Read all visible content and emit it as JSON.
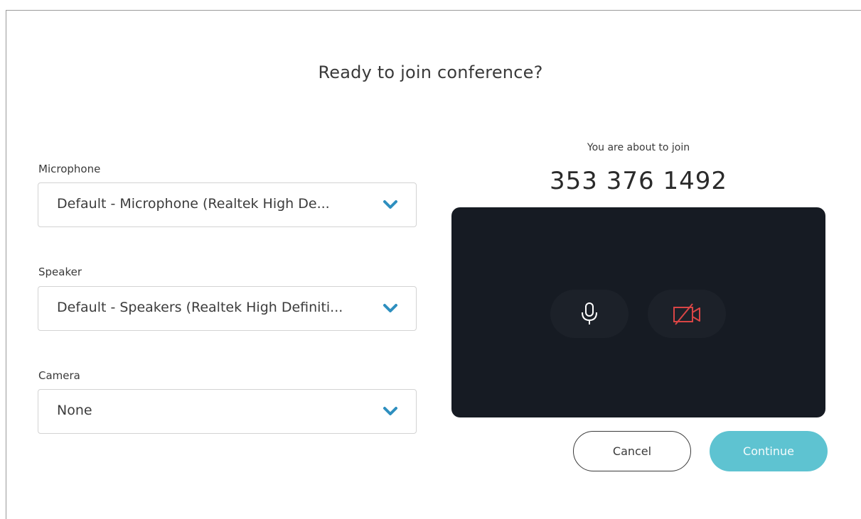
{
  "dialog": {
    "title": "Ready to join conference?"
  },
  "devices": {
    "microphone": {
      "label": "Microphone",
      "value": "Default - Microphone (Realtek High De..."
    },
    "speaker": {
      "label": "Speaker",
      "value": "Default - Speakers (Realtek High Definiti..."
    },
    "camera": {
      "label": "Camera",
      "value": "None"
    }
  },
  "join": {
    "caption": "You are about to join",
    "number": "353 376 1492"
  },
  "preview": {
    "mic_icon": "microphone-icon",
    "camera_icon": "camera-off-icon",
    "background_color": "#161b23",
    "camera_off_color": "#d94545"
  },
  "actions": {
    "cancel_label": "Cancel",
    "continue_label": "Continue",
    "continue_color": "#5ec3d1"
  },
  "colors": {
    "chevron": "#2e8fbf"
  }
}
